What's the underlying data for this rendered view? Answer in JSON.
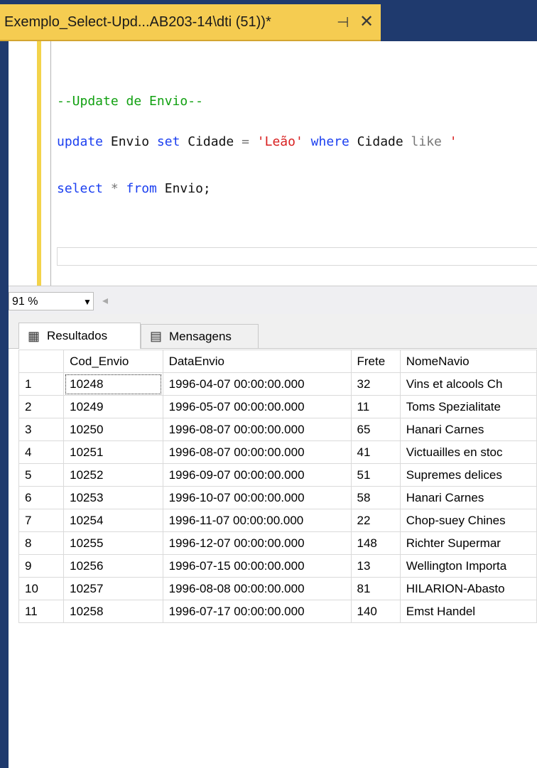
{
  "document_tab": {
    "title": "Exemplo_Select-Upd...AB203-14\\dti (51))*",
    "pin_icon": "⊣",
    "close_icon": "✕"
  },
  "editor": {
    "comment_line": "--Update de Envio--",
    "update_line": {
      "kw_update": "update",
      "t1": " Envio ",
      "kw_set": "set",
      "t2": " Cidade ",
      "op_eq": "=",
      "str": " 'Leão' ",
      "kw_where": "where",
      "t3": " Cidade ",
      "kw_like": "like",
      "str2": " '"
    },
    "select_line": {
      "kw_select": "select",
      "op_star": " * ",
      "kw_from": "from",
      "t1": " Envio;"
    }
  },
  "zoom": {
    "value": "91 %"
  },
  "result_tabs": [
    {
      "label": "Resultados",
      "icon": "grid-icon"
    },
    {
      "label": "Mensagens",
      "icon": "messages-icon"
    }
  ],
  "table": {
    "headers": [
      "",
      "Cod_Envio",
      "DataEnvio",
      "Frete",
      "NomeNavio"
    ],
    "rows": [
      [
        "1",
        "10248",
        "1996-04-07 00:00:00.000",
        "32",
        "Vins et alcools Ch"
      ],
      [
        "2",
        "10249",
        "1996-05-07 00:00:00.000",
        "11",
        "Toms Spezialitate"
      ],
      [
        "3",
        "10250",
        "1996-08-07 00:00:00.000",
        "65",
        "Hanari Carnes"
      ],
      [
        "4",
        "10251",
        "1996-08-07 00:00:00.000",
        "41",
        "Victuailles en stoc"
      ],
      [
        "5",
        "10252",
        "1996-09-07 00:00:00.000",
        "51",
        "Supremes delices"
      ],
      [
        "6",
        "10253",
        "1996-10-07 00:00:00.000",
        "58",
        "Hanari Carnes"
      ],
      [
        "7",
        "10254",
        "1996-11-07 00:00:00.000",
        "22",
        "Chop-suey Chines"
      ],
      [
        "8",
        "10255",
        "1996-12-07 00:00:00.000",
        "148",
        "Richter Supermar"
      ],
      [
        "9",
        "10256",
        "1996-07-15 00:00:00.000",
        "13",
        "Wellington Importa"
      ],
      [
        "10",
        "10257",
        "1996-08-08 00:00:00.000",
        "81",
        "HILARION-Abasto"
      ],
      [
        "11",
        "10258",
        "1996-07-17 00:00:00.000",
        "140",
        "Emst Handel"
      ]
    ]
  },
  "colors": {
    "tab_accent": "#f5cc51",
    "frame": "#1f3a6e",
    "keyword": "#1b3ff0",
    "string": "#d81f1f",
    "comment": "#10a010"
  }
}
